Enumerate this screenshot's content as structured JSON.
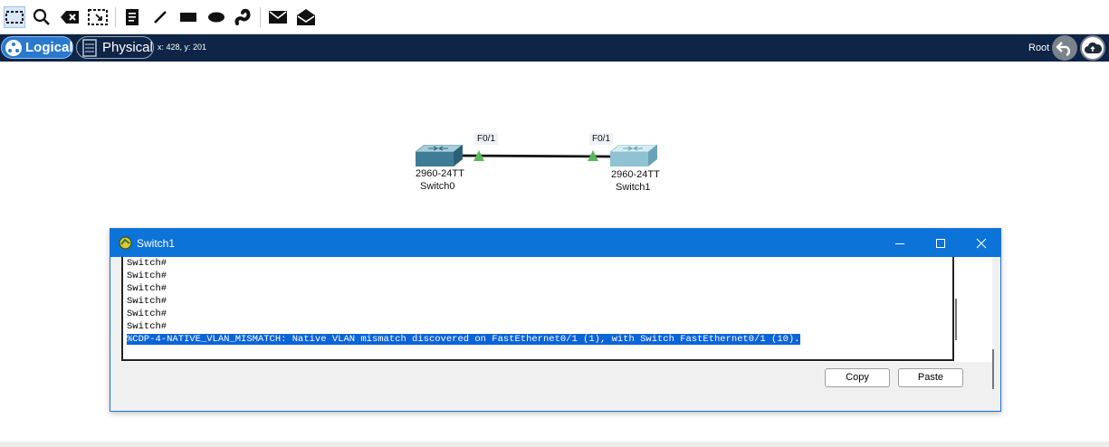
{
  "toolbar": {
    "tools": [
      {
        "name": "select-icon"
      },
      {
        "name": "zoom-icon"
      },
      {
        "name": "delete-icon"
      },
      {
        "name": "resize-icon"
      },
      {
        "name": "note-icon"
      },
      {
        "name": "line-icon"
      },
      {
        "name": "rectangle-icon"
      },
      {
        "name": "ellipse-icon"
      },
      {
        "name": "freehand-icon"
      },
      {
        "name": "add-pdu-icon"
      },
      {
        "name": "add-complex-pdu-icon"
      }
    ]
  },
  "nav": {
    "logical_label": "Logical",
    "physical_label": "Physical",
    "coords": "x: 428, y: 201",
    "root_label": "Root"
  },
  "topology": {
    "devices": [
      {
        "model": "2960-24TT",
        "name": "Switch0"
      },
      {
        "model": "2960-24TT",
        "name": "Switch1"
      }
    ],
    "ports": [
      {
        "label": "F0/1",
        "status_color": "#5cb85c"
      },
      {
        "label": "F0/1",
        "status_color": "#5cb85c"
      }
    ]
  },
  "terminal_window": {
    "title": "Switch1",
    "lines": [
      "Switch#",
      "Switch#",
      "Switch#",
      "Switch#",
      "Switch#",
      "Switch#"
    ],
    "highlighted_line": "%CDP-4-NATIVE_VLAN_MISMATCH: Native VLAN mismatch discovered on FastEthernet0/1 (1), with Switch FastEthernet0/1 (10).",
    "copy_label": "Copy",
    "paste_label": "Paste"
  },
  "colors": {
    "navbar": "#0f2547",
    "logical_pill": "#2a79cf",
    "window_titlebar": "#0c73d9",
    "selection": "#0b64d8",
    "link_up": "#5cb85c"
  }
}
